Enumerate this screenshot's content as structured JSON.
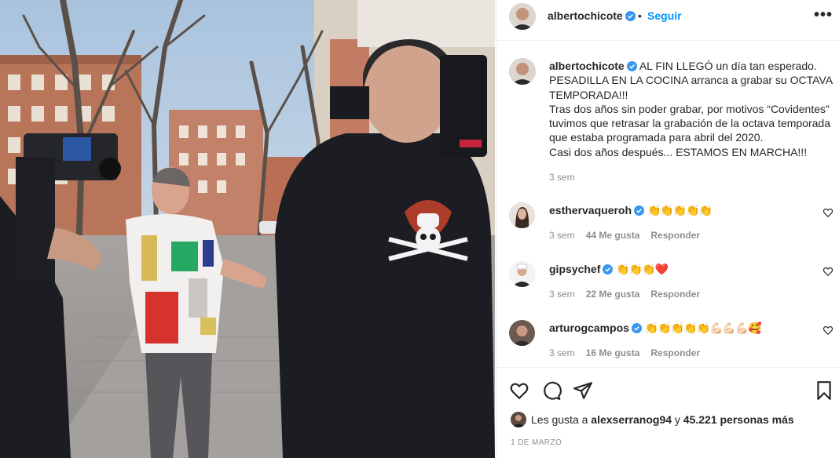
{
  "post": {
    "username": "albertochicote",
    "follow_label": "Seguir",
    "dot": "•",
    "more_label": "•••",
    "caption": {
      "username": "albertochicote",
      "lines": [
        "AL FIN LLEGÓ un día tan esperado.",
        "PESADILLA EN LA COCINA arranca a grabar su OCTAVA",
        "TEMPORADA!!!",
        "Tras dos años sin poder grabar, por motivos “Covidentes”",
        "tuvimos que retrasar la grabación de la octava temporada",
        "que estaba programada para abril del 2020.",
        "Casi dos años después... ESTAMOS EN MARCHA!!!"
      ],
      "time": "3 sem"
    },
    "comments": [
      {
        "username": "esthervaqueroh",
        "verified": true,
        "text": "👏👏👏👏👏",
        "time": "3 sem",
        "likes": "44 Me gusta",
        "reply": "Responder"
      },
      {
        "username": "gipsychef",
        "verified": true,
        "text": "👏👏👏❤️",
        "time": "3 sem",
        "likes": "22 Me gusta",
        "reply": "Responder"
      },
      {
        "username": "arturogcampos",
        "verified": true,
        "text": "👏👏👏👏👏💪🏻💪🏻💪🏻🥰",
        "time": "3 sem",
        "likes": "16 Me gusta",
        "reply": "Responder"
      }
    ],
    "likes": {
      "prefix": "Les gusta a",
      "user": "alexserranog94",
      "conj": "y",
      "others": "45.221 personas más"
    },
    "date": "1 DE MARZO"
  },
  "colors": {
    "accent": "#0095f6",
    "verified": "#3897f0",
    "secondary_text": "#8e8e8e",
    "heart_red": "#ed4956"
  },
  "icons": [
    "verified-badge-icon",
    "more-options-icon",
    "heart-icon",
    "comment-icon",
    "share-icon",
    "bookmark-icon"
  ]
}
